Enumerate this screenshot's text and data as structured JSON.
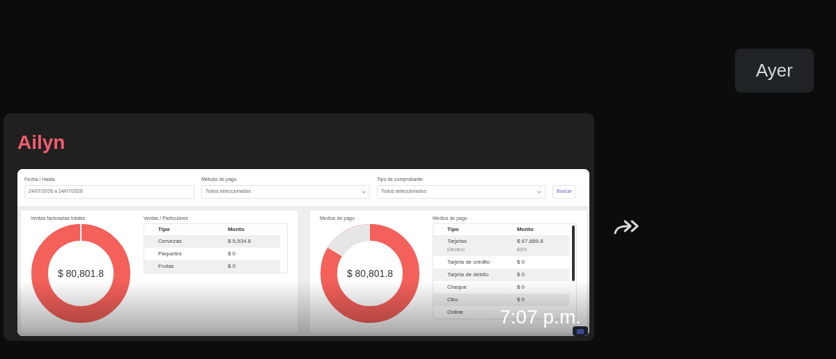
{
  "date_chip": "Ayer",
  "message": {
    "sender": "Ailyn",
    "time": "7:07 p.m.",
    "image": {
      "filters": [
        {
          "kind": "date",
          "label": "Fecha / Hasta",
          "value": "24/07/2026 a 24/07/2026"
        },
        {
          "kind": "select",
          "label": "Método de pago",
          "value": "Todos seleccionados"
        },
        {
          "kind": "select",
          "label": "Tipo de comprobante",
          "value": "Todos seleccionados"
        }
      ],
      "button": "Buscar",
      "panels": [
        {
          "kind": "single",
          "donut_title": "Ventas facturadas totales",
          "total": "$ 80,801.8",
          "table_title": "Ventas / Particulares",
          "columns": [
            "Tipo",
            "Monto"
          ],
          "scrollbar": false,
          "rows": [
            {
              "cells": [
                "Cervezas",
                "$ 5,934.8"
              ]
            },
            {
              "cells": [
                "Paquetes",
                "$ 0"
              ]
            },
            {
              "cells": [
                "Frutas",
                "$ 0"
              ]
            }
          ]
        },
        {
          "kind": "split",
          "donut_title": "Medios de pago",
          "total": "$ 80,801.8",
          "table_title": "Medios de pago",
          "columns": [
            "Tipo",
            "Monto"
          ],
          "scrollbar": true,
          "rows": [
            {
              "cells": [
                "Tarjetas",
                "$ 67,889.8"
              ],
              "sub": [
                "Efectivo",
                "83%"
              ]
            },
            {
              "cells": [
                "Tarjeta de crédito",
                "$ 0"
              ]
            },
            {
              "cells": [
                "Tarjeta de débito",
                "$ 0"
              ]
            },
            {
              "cells": [
                "Cheque",
                "$ 0"
              ]
            },
            {
              "cells": [
                "Otro",
                "$ 0"
              ]
            },
            {
              "cells": [
                "Online"
              ]
            }
          ]
        }
      ]
    }
  }
}
